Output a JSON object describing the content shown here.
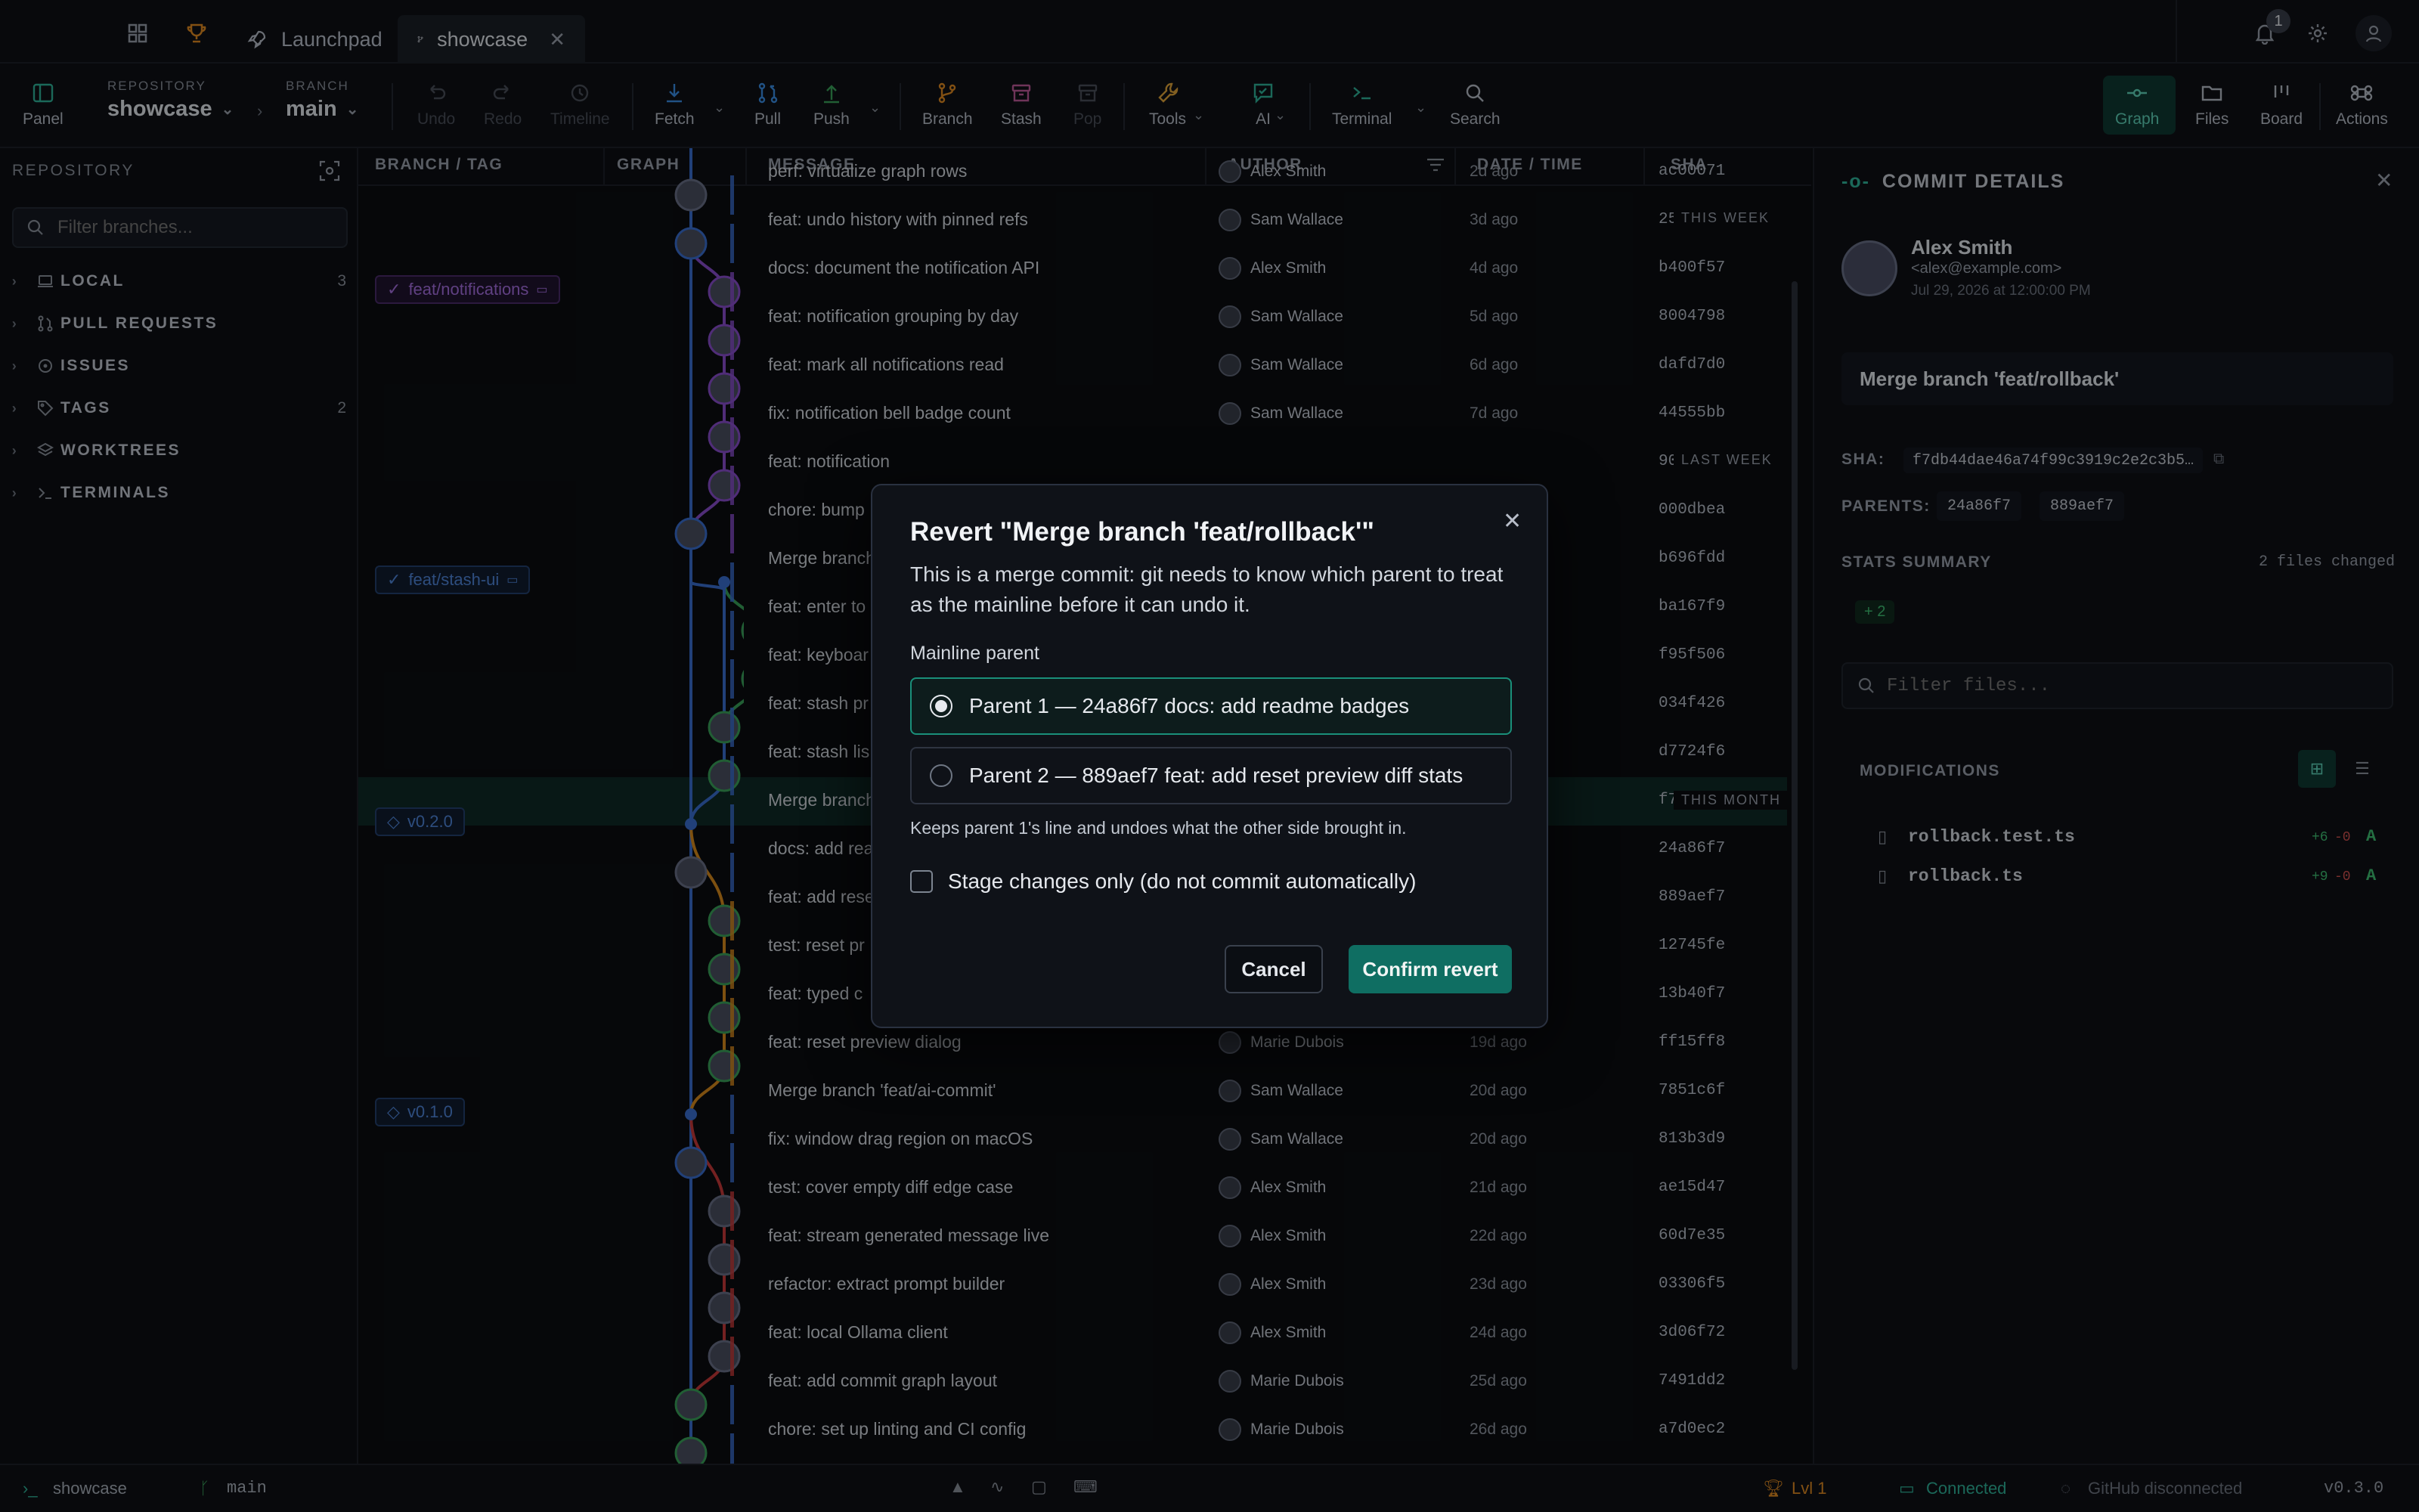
{
  "titlebar": {
    "tabs": [
      {
        "label": "Launchpad"
      },
      {
        "label": "showcase"
      }
    ],
    "notifications_count": "1"
  },
  "toolbar": {
    "panel": "Panel",
    "repository_caption": "REPOSITORY",
    "repository": "showcase",
    "branch_caption": "BRANCH",
    "branch": "main",
    "undo": "Undo",
    "redo": "Redo",
    "timeline": "Timeline",
    "fetch": "Fetch",
    "pull": "Pull",
    "push": "Push",
    "branch_btn": "Branch",
    "stash": "Stash",
    "pop": "Pop",
    "tools": "Tools",
    "ai": "AI",
    "terminal": "Terminal",
    "search": "Search",
    "graph": "Graph",
    "files": "Files",
    "board": "Board",
    "actions": "Actions"
  },
  "sidebar": {
    "title": "REPOSITORY",
    "filter_placeholder": "Filter branches...",
    "sections": [
      {
        "label": "LOCAL",
        "count": "3"
      },
      {
        "label": "PULL REQUESTS",
        "count": ""
      },
      {
        "label": "ISSUES",
        "count": ""
      },
      {
        "label": "TAGS",
        "count": "2"
      },
      {
        "label": "WORKTREES",
        "count": ""
      },
      {
        "label": "TERMINALS",
        "count": ""
      }
    ]
  },
  "graph": {
    "columns": {
      "branch": "BRANCH / TAG",
      "graph": "GRAPH",
      "message": "MESSAGE",
      "author": "AUTHOR",
      "date": "DATE / TIME",
      "sha": "SHA"
    },
    "periods": {
      "this_week": "THIS WEEK",
      "last_week": "LAST WEEK",
      "this_month": "THIS MONTH"
    },
    "refs": {
      "notifications": "feat/notifications",
      "stash_ui": "feat/stash-ui",
      "v020": "v0.2.0",
      "v010": "v0.1.0"
    },
    "rows": [
      {
        "message": "perf: virtualize graph rows",
        "author": "Alex Smith",
        "date": "2d ago",
        "sha": "ac00071"
      },
      {
        "message": "feat: undo history with pinned refs",
        "author": "Sam Wallace",
        "date": "3d ago",
        "sha": "25d50c0"
      },
      {
        "message": "docs: document the notification API",
        "author": "Alex Smith",
        "date": "4d ago",
        "sha": "b400f57"
      },
      {
        "message": "feat: notification grouping by day",
        "author": "Sam Wallace",
        "date": "5d ago",
        "sha": "8004798"
      },
      {
        "message": "feat: mark all notifications read",
        "author": "Sam Wallace",
        "date": "6d ago",
        "sha": "dafd7d0"
      },
      {
        "message": "fix: notification bell badge count",
        "author": "Sam Wallace",
        "date": "7d ago",
        "sha": "44555bb"
      },
      {
        "message": "feat: notification",
        "author": "",
        "date": "",
        "sha": "904d755"
      },
      {
        "message": "chore: bump",
        "author": "",
        "date": "",
        "sha": "000dbea"
      },
      {
        "message": "Merge branch",
        "author": "",
        "date": "",
        "sha": "b696fdd"
      },
      {
        "message": "feat: enter to",
        "author": "",
        "date": "",
        "sha": "ba167f9"
      },
      {
        "message": "feat: keyboar",
        "author": "",
        "date": "",
        "sha": "f95f506"
      },
      {
        "message": "feat: stash pr",
        "author": "",
        "date": "",
        "sha": "034f426"
      },
      {
        "message": "feat: stash lis",
        "author": "",
        "date": "",
        "sha": "d7724f6"
      },
      {
        "message": "Merge branch",
        "author": "",
        "date": "",
        "sha": "f7db44d"
      },
      {
        "message": "docs: add rea",
        "author": "",
        "date": "",
        "sha": "24a86f7"
      },
      {
        "message": "feat: add rese",
        "author": "",
        "date": "",
        "sha": "889aef7"
      },
      {
        "message": "test: reset pr",
        "author": "",
        "date": "",
        "sha": "12745fe"
      },
      {
        "message": "feat: typed c",
        "author": "",
        "date": "",
        "sha": "13b40f7"
      },
      {
        "message": "feat: reset preview dialog",
        "author": "Marie Dubois",
        "date": "19d ago",
        "sha": "ff15ff8"
      },
      {
        "message": "Merge branch 'feat/ai-commit'",
        "author": "Sam Wallace",
        "date": "20d ago",
        "sha": "7851c6f"
      },
      {
        "message": "fix: window drag region on macOS",
        "author": "Sam Wallace",
        "date": "20d ago",
        "sha": "813b3d9"
      },
      {
        "message": "test: cover empty diff edge case",
        "author": "Alex Smith",
        "date": "21d ago",
        "sha": "ae15d47"
      },
      {
        "message": "feat: stream generated message live",
        "author": "Alex Smith",
        "date": "22d ago",
        "sha": "60d7e35"
      },
      {
        "message": "refactor: extract prompt builder",
        "author": "Alex Smith",
        "date": "23d ago",
        "sha": "03306f5"
      },
      {
        "message": "feat: local Ollama client",
        "author": "Alex Smith",
        "date": "24d ago",
        "sha": "3d06f72"
      },
      {
        "message": "feat: add commit graph layout",
        "author": "Marie Dubois",
        "date": "25d ago",
        "sha": "7491dd2"
      },
      {
        "message": "chore: set up linting and CI config",
        "author": "Marie Dubois",
        "date": "26d ago",
        "sha": "a7d0ec2"
      }
    ]
  },
  "details": {
    "title": "COMMIT DETAILS",
    "author": "Alex Smith",
    "email": "<alex@example.com>",
    "date": "Jul 29, 2026 at 12:00:00 PM",
    "subject": "Merge branch 'feat/rollback'",
    "sha_label": "SHA:",
    "sha": "f7db44dae46a74f99c3919c2e2c3b5…",
    "parents_label": "PARENTS:",
    "parents": [
      "24a86f7",
      "889aef7"
    ],
    "stats_label": "STATS SUMMARY",
    "files_changed": "2 files changed",
    "additions": "+ 2",
    "filter_placeholder": "Filter files...",
    "modifications": "MODIFICATIONS",
    "files": [
      {
        "name": "rollback.test.ts",
        "add": "+6",
        "del": "-0",
        "status": "A"
      },
      {
        "name": "rollback.ts",
        "add": "+9",
        "del": "-0",
        "status": "A"
      }
    ]
  },
  "modal": {
    "title": "Revert \"Merge branch 'feat/rollback'\"",
    "body": "This is a merge commit: git needs to know which parent to treat as the mainline before it can undo it.",
    "mainline_label": "Mainline parent",
    "option1": "Parent 1 — 24a86f7 docs: add readme badges",
    "option2": "Parent 2 — 889aef7 feat: add reset preview diff stats",
    "hint": "Keeps parent 1's line and undoes what the other side brought in.",
    "checkbox": "Stage changes only (do not commit automatically)",
    "cancel": "Cancel",
    "confirm": "Confirm revert"
  },
  "statusbar": {
    "repo": "showcase",
    "branch": "main",
    "level": "Lvl 1",
    "connected": "Connected",
    "github": "GitHub disconnected",
    "version": "v0.3.0"
  },
  "colors": {
    "accent": "#1a8f7a",
    "teal_bg": "#0f6e62",
    "purple": "#8a4fcf",
    "orange": "#d88a1c",
    "red": "#c83a3a",
    "blue": "#3a6ed0",
    "green": "#3aa35a"
  }
}
